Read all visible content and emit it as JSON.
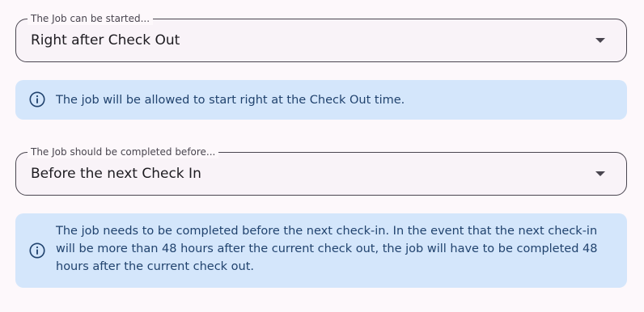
{
  "start": {
    "label": "The Job can be started...",
    "value": "Right after Check Out",
    "info": "The job will be allowed to start right at the Check Out time.",
    "caret_icon": "arrow-drop-down-icon",
    "info_icon": "info-circle-icon"
  },
  "complete": {
    "label": "The Job should be completed before...",
    "value": "Before the next Check In",
    "info": "The job needs to be completed before the next check-in. In the event that the next check-in will be more than 48 hours after the current check out, the job will have to be completed 48 hours after the current check out.",
    "caret_icon": "arrow-drop-down-icon",
    "info_icon": "info-circle-icon"
  },
  "colors": {
    "info_background": "#d4e6fb",
    "info_text": "#21436e",
    "field_border": "#4a4650",
    "page_background": "#fdf8fb"
  }
}
